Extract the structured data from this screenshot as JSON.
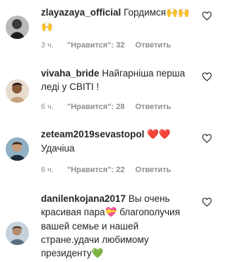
{
  "comments": [
    {
      "username": "zlayazaya_official",
      "text": "Гордимся",
      "emoji": "🙌🙌",
      "emoji_line2": "🙌",
      "time": "3 ч.",
      "likes": "\"Нравится\": 32",
      "reply": "Ответить"
    },
    {
      "username": "vivaha_bride",
      "text": "Найгарніша перша леді у СВІТІ !",
      "time": "6 ч.",
      "likes": "\"Нравится\": 28",
      "reply": "Ответить"
    },
    {
      "username": "zeteam2019sevastopol",
      "emoji": "❤️❤️",
      "text_line2": "Удачіua",
      "time": "6 ч.",
      "likes": "\"Нравится\": 22",
      "reply": "Ответить"
    },
    {
      "username": "danilenkojana2017",
      "text_a": "Вы очень красивая пара",
      "emoji_a": "💝",
      "text_b": "благополучия вашей семье и нашей стране.удачи любимому президенту",
      "emoji_b": "💚"
    }
  ],
  "icons": {
    "like": "heart-outline-icon"
  },
  "colors": {
    "meta": "#8e8e8e",
    "text": "#262626",
    "heart_red": "#ed4956",
    "green_heart": "#34c759"
  }
}
